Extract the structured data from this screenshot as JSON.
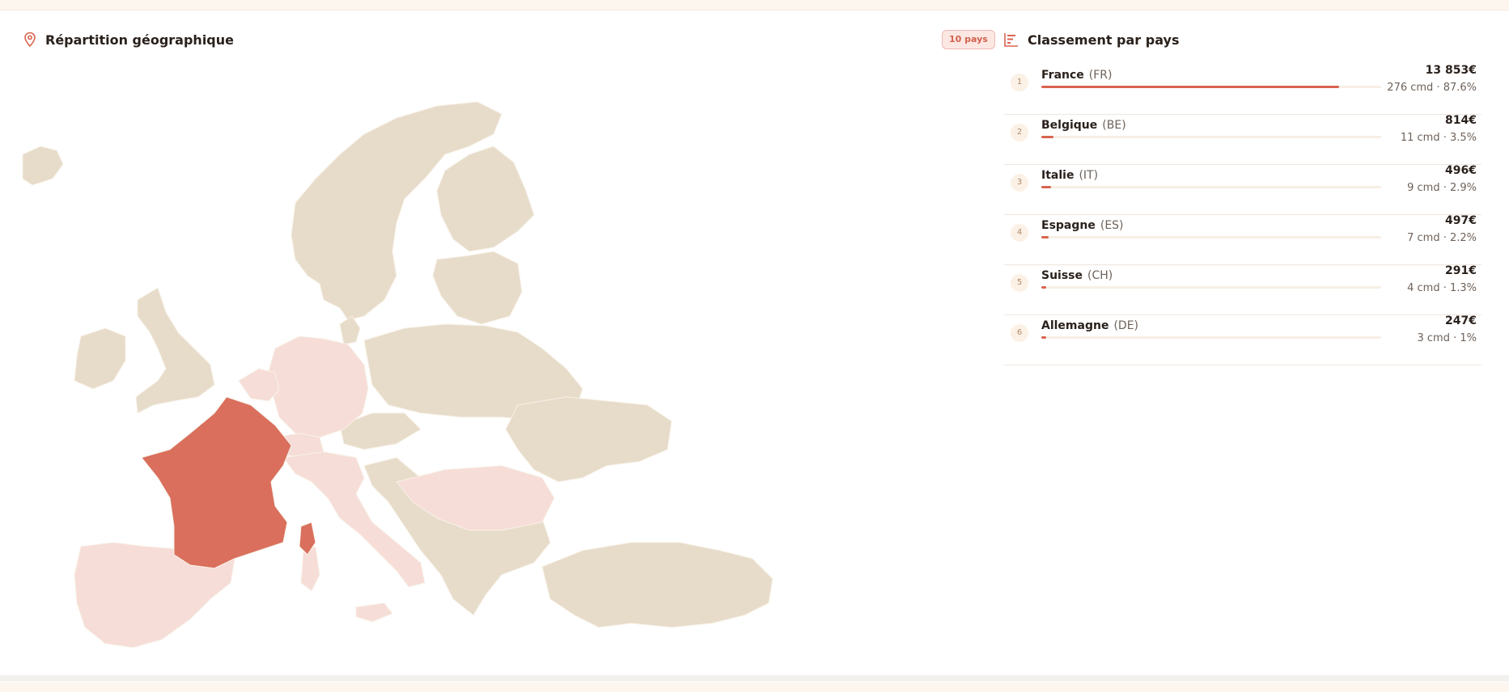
{
  "colors": {
    "accent": "#d96450",
    "highlight_strong": "#d96f5c",
    "highlight_light": "#f7ddd7",
    "land": "#e7dcc9",
    "land_border": "#f7f1e8"
  },
  "map": {
    "title": "Répartition géographique",
    "icon": "map-pin-icon"
  },
  "badge": "10 pays",
  "ranking": {
    "title": "Classement par pays",
    "icon": "ranking-bars-icon",
    "items": [
      {
        "rank": "1",
        "name": "France",
        "code": "(FR)",
        "amount": "13 853€",
        "meta": "276 cmd · 87.6%",
        "share": 0.876
      },
      {
        "rank": "2",
        "name": "Belgique",
        "code": "(BE)",
        "amount": "814€",
        "meta": "11 cmd · 3.5%",
        "share": 0.035
      },
      {
        "rank": "3",
        "name": "Italie",
        "code": "(IT)",
        "amount": "496€",
        "meta": "9 cmd · 2.9%",
        "share": 0.029
      },
      {
        "rank": "4",
        "name": "Espagne",
        "code": "(ES)",
        "amount": "497€",
        "meta": "7 cmd · 2.2%",
        "share": 0.022
      },
      {
        "rank": "5",
        "name": "Suisse",
        "code": "(CH)",
        "amount": "291€",
        "meta": "4 cmd · 1.3%",
        "share": 0.013
      },
      {
        "rank": "6",
        "name": "Allemagne",
        "code": "(DE)",
        "amount": "247€",
        "meta": "3 cmd · 1%",
        "share": 0.01
      }
    ]
  }
}
